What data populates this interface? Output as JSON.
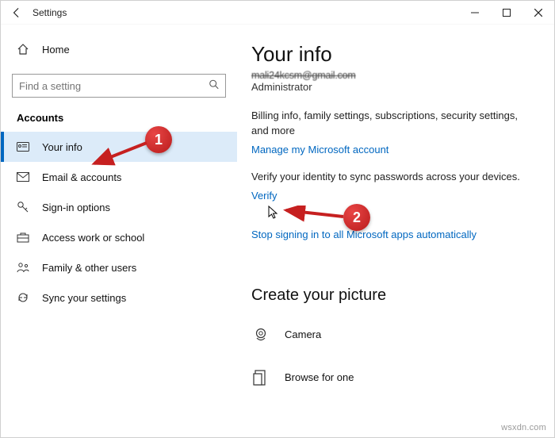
{
  "window": {
    "title": "Settings"
  },
  "sidebar": {
    "home": "Home",
    "search_placeholder": "Find a setting",
    "section": "Accounts",
    "items": [
      {
        "label": "Your info"
      },
      {
        "label": "Email & accounts"
      },
      {
        "label": "Sign-in options"
      },
      {
        "label": "Access work or school"
      },
      {
        "label": "Family & other users"
      },
      {
        "label": "Sync your settings"
      }
    ]
  },
  "main": {
    "heading": "Your info",
    "email": "mali24kcsm@gmail.com",
    "role": "Administrator",
    "billing_text": "Billing info, family settings, subscriptions, security settings, and more",
    "manage_link": "Manage my Microsoft account",
    "verify_text": "Verify your identity to sync passwords across your devices.",
    "verify_link": "Verify",
    "stop_link": "Stop signing in to all Microsoft apps automatically",
    "picture_heading": "Create your picture",
    "camera_label": "Camera",
    "browse_label": "Browse for one"
  },
  "annotations": {
    "badge1": "1",
    "badge2": "2"
  },
  "colors": {
    "accent": "#0067c0",
    "badge": "#c62020"
  },
  "watermark": "wsxdn.com"
}
